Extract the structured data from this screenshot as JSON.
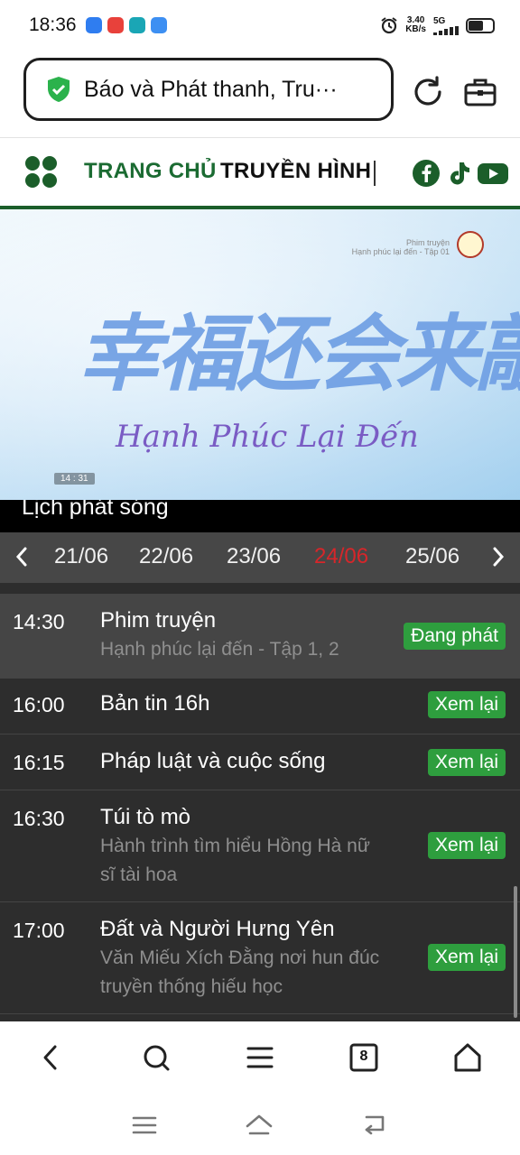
{
  "status_bar": {
    "time": "18:36",
    "net_speed_value": "3.40",
    "net_speed_unit": "KB/s",
    "net_type": "5G",
    "icons": [
      "app-icon-blue",
      "app-icon-red",
      "app-icon-teal",
      "app-icon-doc",
      "alarm-icon",
      "signal-icon",
      "battery-icon"
    ]
  },
  "address_bar": {
    "text": "Báo và Phát thanh, Tru···",
    "icons": [
      "shield-check-icon",
      "reload-icon",
      "toolbox-icon"
    ]
  },
  "site_nav": {
    "home": "TRANG CHỦ",
    "tv": "TRUYỀN HÌNH",
    "social": [
      "facebook-icon",
      "tiktok-icon",
      "youtube-icon"
    ],
    "brand_color": "#1b5e2a"
  },
  "video": {
    "cn_title": "幸福还会来敲门",
    "vn_title": "Hạnh Phúc Lại Đến",
    "osd_line1": "Phim truyện",
    "osd_line2": "Hạnh phúc lại đến - Tập 01",
    "osd_time": "14 : 31"
  },
  "schedule": {
    "title": "Lịch phát sóng",
    "dates": [
      "21/06",
      "22/06",
      "23/06",
      "24/06",
      "25/06"
    ],
    "active_date": "24/06",
    "active_color": "#d7262a",
    "rows": [
      {
        "time": "14:30",
        "title": "Phim truyện",
        "desc": "Hạnh phúc lại đến - Tập 1, 2",
        "action": "Đang phát"
      },
      {
        "time": "16:00",
        "title": "Bản tin 16h",
        "desc": "",
        "action": "Xem lại"
      },
      {
        "time": "16:15",
        "title": "Pháp luật và cuộc sống",
        "desc": "",
        "action": "Xem lại"
      },
      {
        "time": "16:30",
        "title": "Túi tò mò",
        "desc": "Hành trình tìm hiểu Hồng Hà nữ sĩ tài hoa",
        "action": "Xem lại"
      },
      {
        "time": "17:00",
        "title": "Đất và Người Hưng Yên",
        "desc": "Văn Miếu Xích Đằng nơi hun đúc truyền thống hiếu học",
        "action": "Xem lại"
      }
    ],
    "button_color": "#2e9e3e"
  },
  "browser_toolbar": {
    "tab_count": "8",
    "icons": [
      "back-icon",
      "search-icon",
      "menu-icon",
      "tabs-icon",
      "home-icon"
    ]
  },
  "system_nav": {
    "icons": [
      "recents-icon",
      "home-icon",
      "back-icon"
    ]
  }
}
